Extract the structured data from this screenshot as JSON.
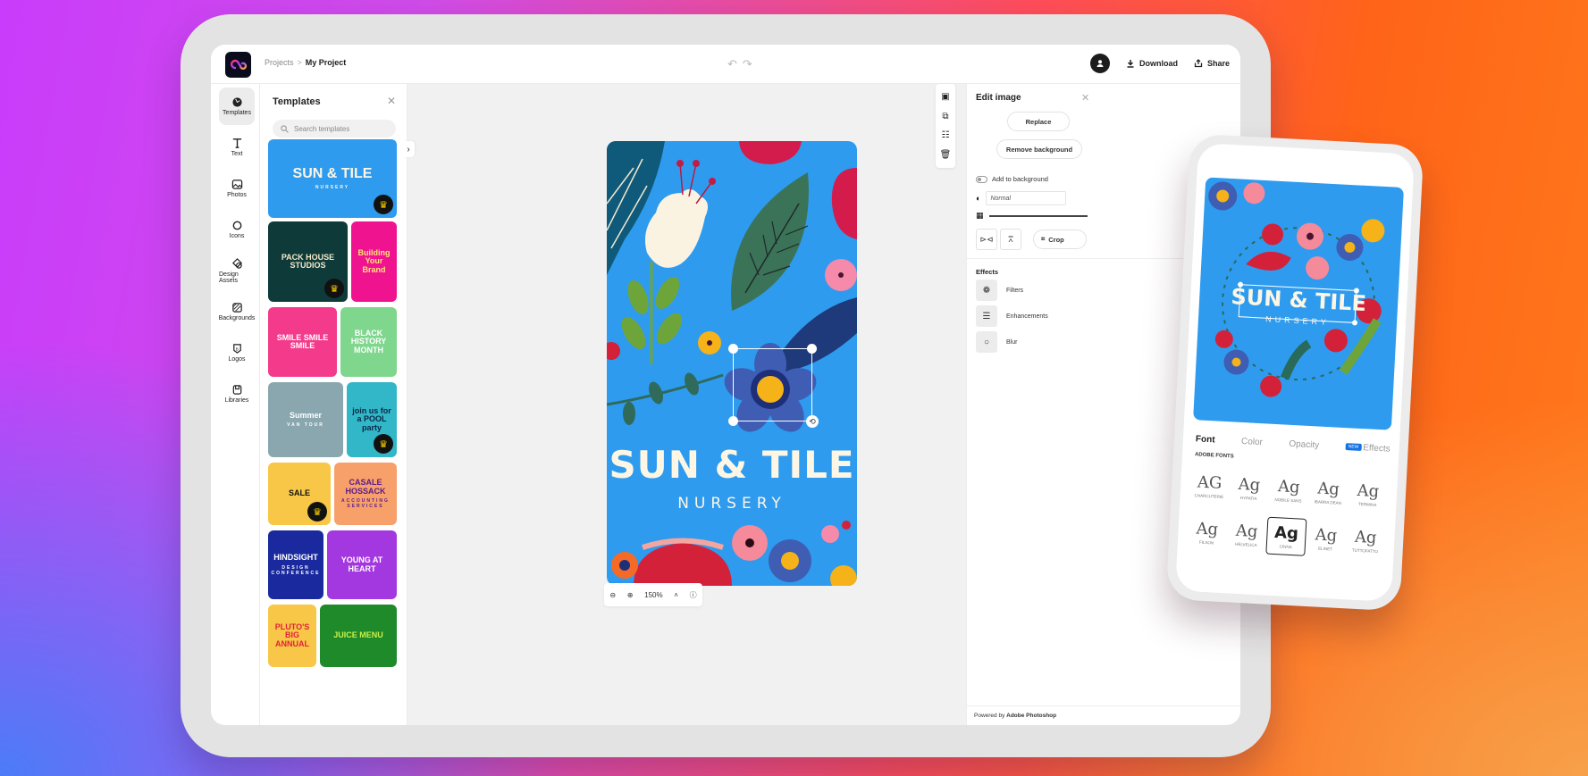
{
  "header": {
    "breadcrumb": {
      "parent": "Projects",
      "separator": ">",
      "current": "My Project"
    },
    "undo_icon": "undo-icon",
    "redo_icon": "redo-icon",
    "download_label": "Download",
    "share_label": "Share"
  },
  "rail": {
    "items": [
      {
        "label": "Templates",
        "icon": "templates-icon",
        "active": true
      },
      {
        "label": "Text",
        "icon": "text-icon"
      },
      {
        "label": "Photos",
        "icon": "photos-icon"
      },
      {
        "label": "Icons",
        "icon": "icons-icon"
      },
      {
        "label": "Design Assets",
        "icon": "design-assets-icon"
      },
      {
        "label": "Backgrounds",
        "icon": "backgrounds-icon"
      },
      {
        "label": "Logos",
        "icon": "logos-icon"
      },
      {
        "label": "Libraries",
        "icon": "libraries-icon"
      }
    ]
  },
  "templates_panel": {
    "title": "Templates",
    "search_placeholder": "Search templates",
    "cards": [
      {
        "title": "SUN & TILE",
        "subtitle": "NURSERY",
        "premium": true,
        "bg": "#2e9bef",
        "fg": "#fdf6e4"
      },
      {
        "title": "PACK HOUSE STUDIOS",
        "premium": true,
        "bg": "#0f3a3a",
        "fg": "#f4e9c8"
      },
      {
        "title": "Building Your Brand",
        "premium": false,
        "bg": "#f0138f",
        "fg": "#ffe37a"
      },
      {
        "title": "SMILE SMILE SMILE",
        "premium": false,
        "bg": "#f43a8a",
        "fg": "#ffffff"
      },
      {
        "title": "BLACK HISTORY MONTH",
        "premium": false,
        "bg": "#7fd68d",
        "fg": "#ffffff"
      },
      {
        "title": "Summer",
        "subtitle": "VAN TOUR",
        "premium": false,
        "bg": "#8aa7b0",
        "fg": "#ffffff"
      },
      {
        "title": "join us for a POOL party",
        "premium": true,
        "bg": "#31b7c8",
        "fg": "#0b2746"
      },
      {
        "title": "SALE",
        "premium": true,
        "bg": "#f8c747",
        "fg": "#111111"
      },
      {
        "title": "CASALE HOSSACK",
        "subtitle": "ACCOUNTING SERVICES",
        "premium": false,
        "bg": "#f7a06a",
        "fg": "#5a1a8a"
      },
      {
        "title": "HINDSIGHT",
        "subtitle": "DESIGN CONFERENCE",
        "premium": false,
        "bg": "#1a2a9e",
        "fg": "#ffffff"
      },
      {
        "title": "YOUNG AT HEART",
        "premium": false,
        "bg": "#a438e0",
        "fg": "#ffffff"
      },
      {
        "title": "PLUTO'S BIG ANNUAL",
        "premium": false,
        "bg": "#f8c747",
        "fg": "#e0223a"
      },
      {
        "title": "JUICE MENU",
        "premium": false,
        "bg": "#1f8a2a",
        "fg": "#c8f04a"
      }
    ]
  },
  "canvas": {
    "title": "SUN & TILE",
    "subtitle": "NURSERY",
    "background": "#2e9bef",
    "zoom_level": "150%"
  },
  "edit_panel": {
    "title": "Edit image",
    "replace_label": "Replace",
    "remove_bg_label": "Remove background",
    "add_to_background_label": "Add to background",
    "add_to_background_on": false,
    "blend_mode": "Normal",
    "crop_label": "Crop",
    "effects_title": "Effects",
    "effects": [
      {
        "label": "Filters",
        "icon": "filters-icon"
      },
      {
        "label": "Enhancements",
        "icon": "enhancements-icon"
      },
      {
        "label": "Blur",
        "icon": "blur-icon"
      }
    ],
    "powered_prefix": "Powered by",
    "powered_brand": "Adobe Photoshop"
  },
  "phone": {
    "art_title": "SUN & TILE",
    "art_subtitle": "NURSERY",
    "tabs": [
      "Font",
      "Color",
      "Opacity",
      "Effects"
    ],
    "active_tab": "Font",
    "new_badge": "NEW",
    "fonts_label": "ADOBE FONTS",
    "fonts": [
      {
        "sample": "AG",
        "name": "Charcuterie"
      },
      {
        "sample": "Ag",
        "name": "Hypatia"
      },
      {
        "sample": "Ag",
        "name": "Nobile Sans"
      },
      {
        "sample": "Ag",
        "name": "Ibarra Dean"
      },
      {
        "sample": "Ag",
        "name": "Termina"
      },
      {
        "sample": "Ag",
        "name": "Filson"
      },
      {
        "sample": "Ag",
        "name": "Helvelica"
      },
      {
        "sample": "Ag",
        "name": "Cinna",
        "selected": true
      },
      {
        "sample": "Ag",
        "name": "Elinet"
      },
      {
        "sample": "Ag",
        "name": "Tuttofatto"
      }
    ]
  }
}
